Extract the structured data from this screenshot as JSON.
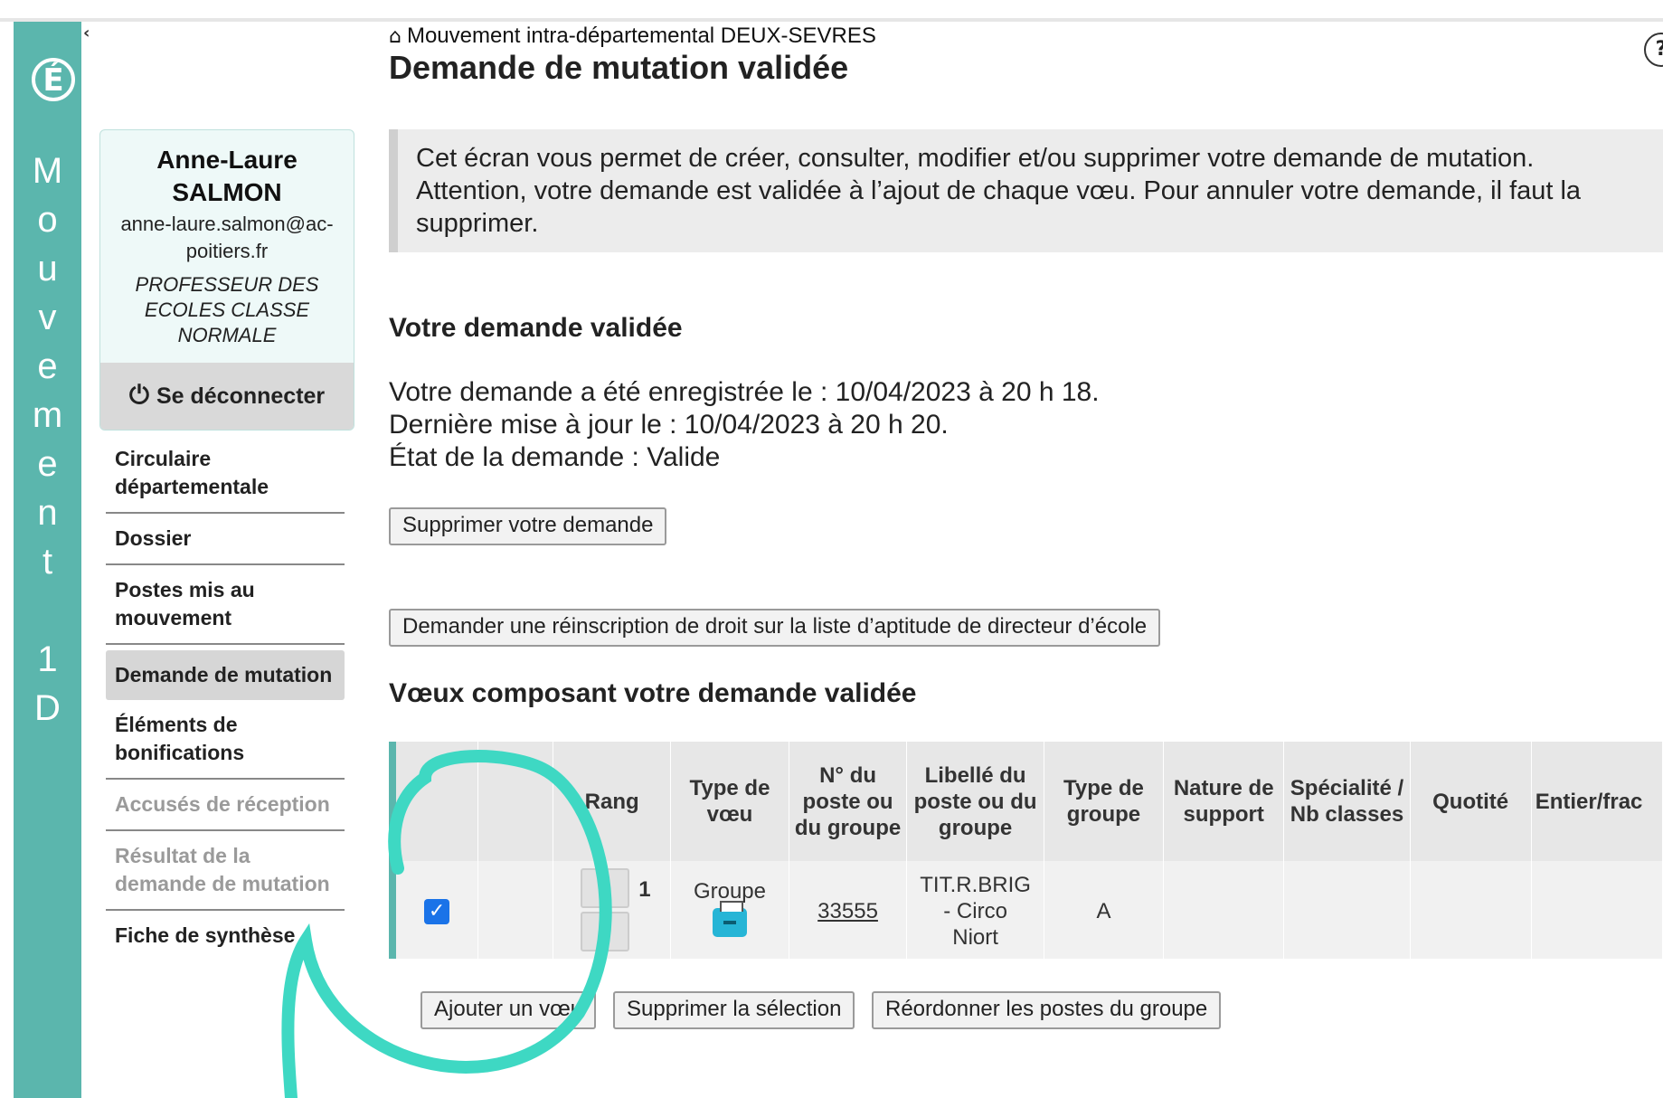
{
  "app": {
    "brand_letters": [
      "M",
      "o",
      "u",
      "v",
      "e",
      "m",
      "e",
      "n",
      "t",
      "",
      "1",
      "D"
    ],
    "logo_glyph": "É",
    "collapse_glyph": "‹"
  },
  "header": {
    "breadcrumb": "Mouvement intra-départemental DEUX-SEVRES",
    "title": "Demande de mutation validée",
    "help_glyph": "?"
  },
  "user": {
    "first_name": "Anne-Laure",
    "last_name": "SALMON",
    "email_line1": "anne-laure.salmon@ac-",
    "email_line2": "poitiers.fr",
    "role_line1": "PROFESSEUR DES",
    "role_line2": "ECOLES CLASSE",
    "role_line3": "NORMALE",
    "logout_label": "Se déconnecter"
  },
  "menu": [
    {
      "label": "Circulaire départementale",
      "state": "normal"
    },
    {
      "label": "Dossier",
      "state": "normal"
    },
    {
      "label": "Postes mis au mouvement",
      "state": "normal"
    },
    {
      "label": "Demande de mutation",
      "state": "active"
    },
    {
      "label": "Éléments de bonifications",
      "state": "normal"
    },
    {
      "label": "Accusés de réception",
      "state": "disabled"
    },
    {
      "label": "Résultat de la demande de mutation",
      "state": "disabled"
    },
    {
      "label": "Fiche de synthèse",
      "state": "normal"
    }
  ],
  "info": {
    "line1": "Cet écran vous permet de créer, consulter, modifier et/ou supprimer votre demande de mutation.",
    "line2": "Attention, votre demande est validée à l’ajout de chaque vœu. Pour annuler votre demande, il faut la",
    "line3": "supprimer."
  },
  "section_validated": {
    "heading": "Votre demande validée",
    "registered": "Votre demande a été enregistrée le : 10/04/2023 à 20 h 18.",
    "updated": "Dernière mise à jour le : 10/04/2023 à 20 h 20.",
    "state": "État de la demande : Valide",
    "delete_button": "Supprimer votre demande",
    "reinscription_button": "Demander une réinscription de droit sur la liste d’aptitude de directeur d’école"
  },
  "wishes": {
    "heading": "Vœux composant votre demande validée",
    "columns": [
      "",
      "",
      "Rang",
      "Type de vœu",
      "N° du poste ou du groupe",
      "Libellé du poste ou du groupe",
      "Type de groupe",
      "Nature de support",
      "Spécialité / Nb classes",
      "Quotité",
      "Entier/frac"
    ],
    "rows": [
      {
        "checked": true,
        "rank": "1",
        "type": "Groupe",
        "number": "33555",
        "label": "TIT.R.BRIG - Circo Niort",
        "group_type": "A",
        "support": "",
        "specialite": "",
        "quotite": "",
        "entier": ""
      }
    ],
    "buttons": {
      "add": "Ajouter un vœu",
      "delete_selection": "Supprimer la sélection",
      "reorder": "Réordonner les postes du groupe"
    }
  },
  "colors": {
    "brand": "#5bb6ad",
    "annotation": "#3ed8c3",
    "checkbox": "#1a73e8"
  }
}
